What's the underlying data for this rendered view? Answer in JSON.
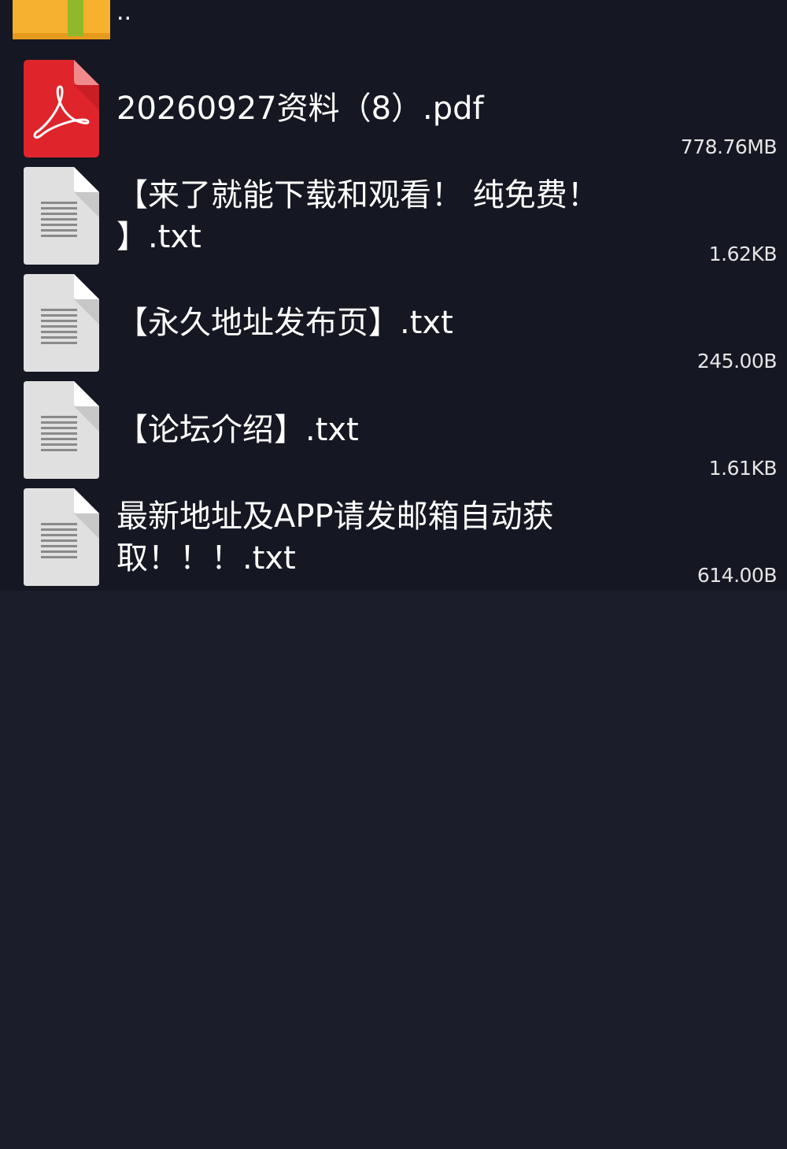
{
  "parent": {
    "label": "..",
    "icon": "folder-icon",
    "icon_color": "#f6b12e"
  },
  "files": [
    {
      "name": "20260927资料（8）.pdf",
      "size": "778.76MB",
      "icon": "pdf-icon",
      "icon_color": "#e0242b"
    },
    {
      "name": "【来了就能下载和观看！ 纯免费！ 】.txt",
      "size": "1.62KB",
      "icon": "text-file-icon",
      "icon_color": "#e0e0e0"
    },
    {
      "name": "【永久地址发布页】.txt",
      "size": "245.00B",
      "icon": "text-file-icon",
      "icon_color": "#e0e0e0"
    },
    {
      "name": "【论坛介绍】.txt",
      "size": "1.61KB",
      "icon": "text-file-icon",
      "icon_color": "#e0e0e0"
    },
    {
      "name": "最新地址及APP请发邮箱自动获取！！！.txt",
      "size": "614.00B",
      "icon": "text-file-icon",
      "icon_color": "#e0e0e0"
    }
  ],
  "theme": {
    "background": "#1b1d2a",
    "list_background": "#151722"
  }
}
